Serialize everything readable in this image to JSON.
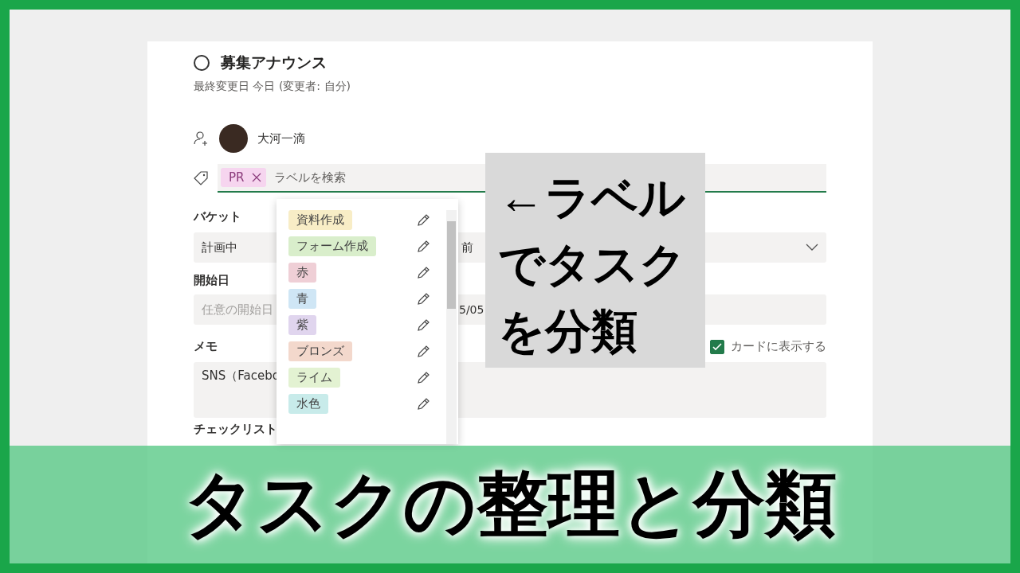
{
  "task": {
    "title": "募集アナウンス",
    "completed": false,
    "modified": "最終変更日 今日 (変更者: 自分)"
  },
  "assignee": {
    "name": "大河一滴"
  },
  "label_field": {
    "chips": [
      {
        "text": "PR",
        "color": "#f6d5ef"
      }
    ],
    "placeholder": "ラベルを検索"
  },
  "bucket": {
    "label": "バケット",
    "value": "計画中"
  },
  "progress": {
    "value": "前"
  },
  "start_date": {
    "label": "開始日",
    "placeholder": "任意の開始日"
  },
  "due_date": {
    "value": "5/05"
  },
  "memo": {
    "label": "メモ",
    "value": "SNS（Facebo",
    "show_on_card": {
      "label": "カードに表示する",
      "checked": true
    }
  },
  "checklist": {
    "label": "チェックリスト"
  },
  "label_menu": {
    "items": [
      {
        "text": "資料作成",
        "color": "#f8edc6"
      },
      {
        "text": "フォーム作成",
        "color": "#d9eecb"
      },
      {
        "text": "赤",
        "color": "#efcfd6"
      },
      {
        "text": "青",
        "color": "#cfe6f5"
      },
      {
        "text": "紫",
        "color": "#e0d5ee"
      },
      {
        "text": "ブロンズ",
        "color": "#f3d8cc"
      },
      {
        "text": "ライム",
        "color": "#e3f2d2"
      },
      {
        "text": "水色",
        "color": "#c8ebea"
      }
    ]
  },
  "callout": {
    "lines": [
      "←ラベル",
      "でタスク",
      "を分類"
    ]
  },
  "banner": {
    "title": "タスクの整理と分類"
  }
}
